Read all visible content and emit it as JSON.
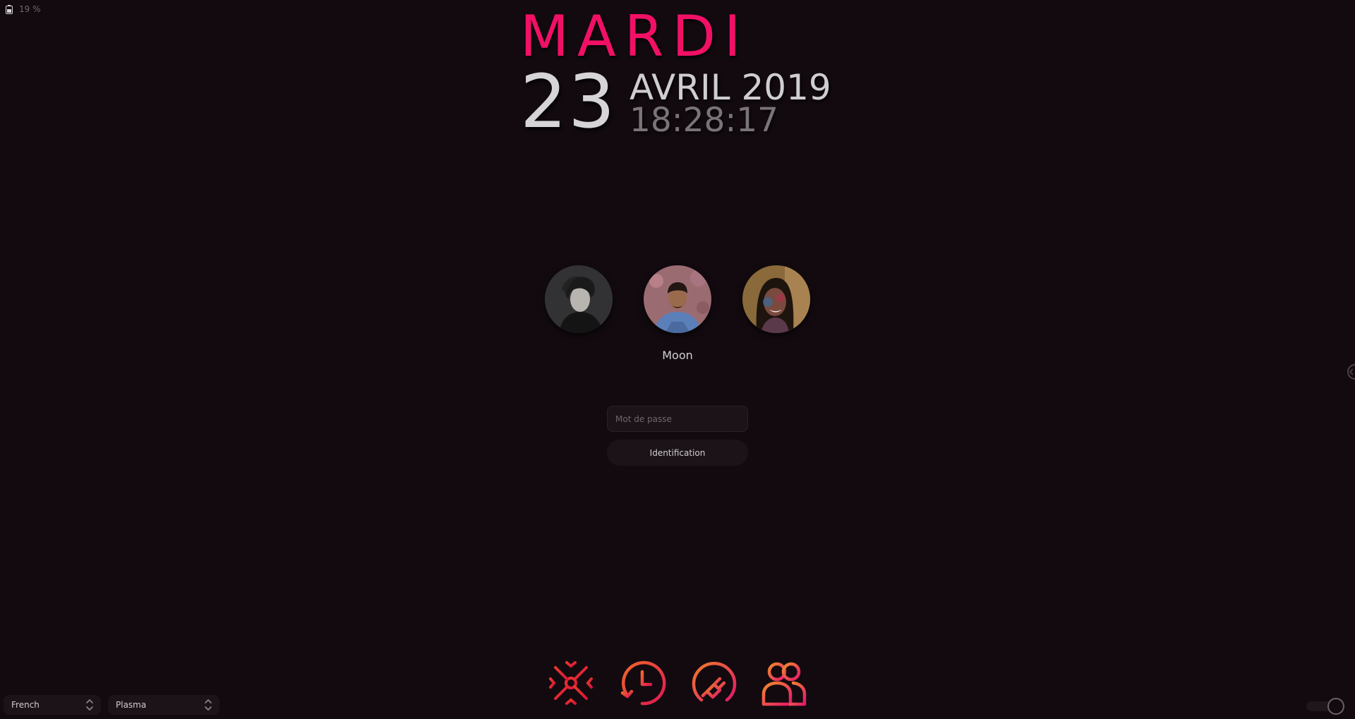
{
  "battery": {
    "text": "19 %",
    "icon": "battery-icon"
  },
  "clock": {
    "day_name": "MARDI",
    "day_number": "23",
    "month_year": "AVRIL 2019",
    "time": "18:28:17"
  },
  "users": {
    "items": [
      {
        "name": "",
        "avatar": "user-avatar-portrait"
      },
      {
        "name": "Moon",
        "avatar": "user-avatar-portrait",
        "selected": true
      },
      {
        "name": "",
        "avatar": "user-avatar-portrait"
      }
    ],
    "selected_name": "Moon"
  },
  "login": {
    "password_placeholder": "Mot de passe",
    "password_value": "",
    "button_label": "Identification"
  },
  "actions": [
    {
      "icon": "suspend-snowflake-icon"
    },
    {
      "icon": "hibernate-clock-icon"
    },
    {
      "icon": "shutdown-plug-icon"
    },
    {
      "icon": "switch-user-icon"
    }
  ],
  "selectors": {
    "keyboard_layout": "French",
    "session": "Plasma"
  },
  "colors": {
    "background": "#120a0f",
    "accent": "#f21066",
    "accent_orange": "#f05a28",
    "text": "#d0cdd0"
  }
}
